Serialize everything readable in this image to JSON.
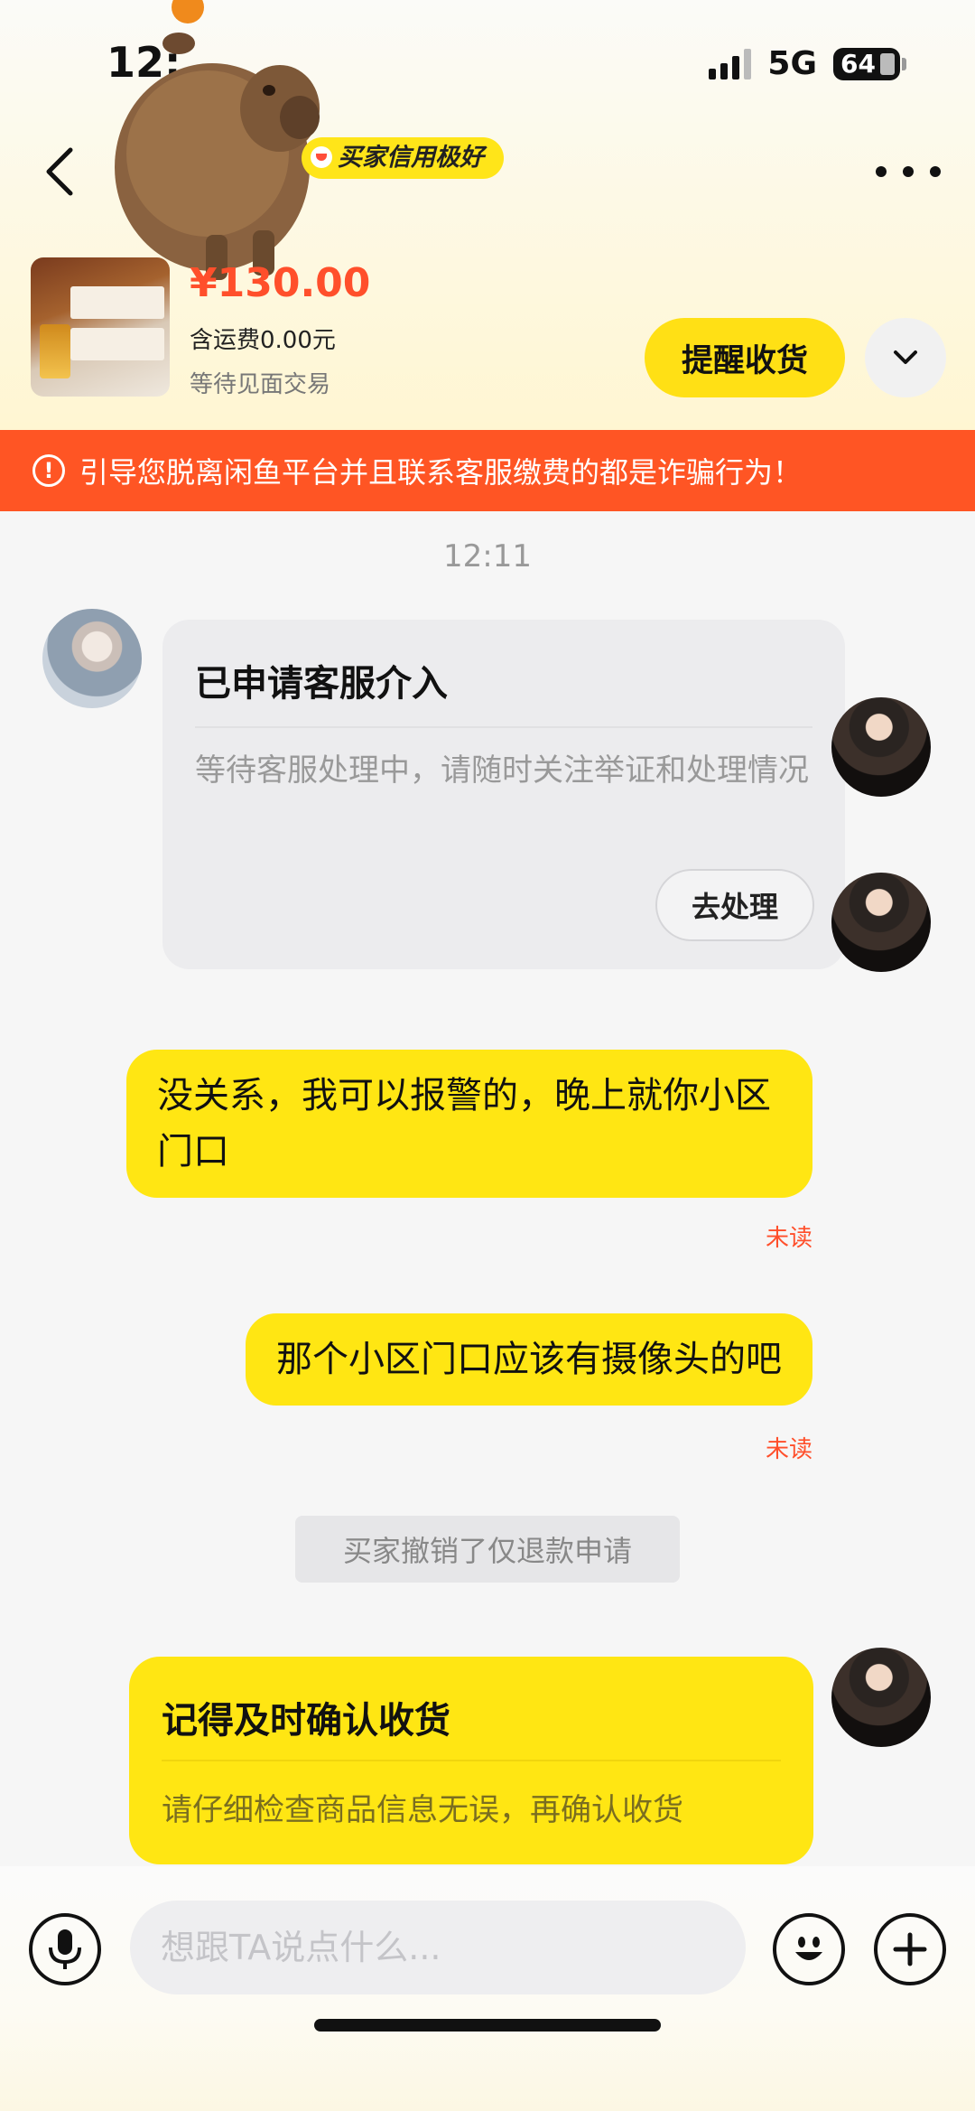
{
  "status_bar": {
    "time": "12:",
    "network": "5G",
    "battery": "64"
  },
  "header": {
    "credit_badge": "买家信用极好",
    "price": "¥130.00",
    "shipping": "含运费0.00元",
    "trade_status": "等待见面交易",
    "remind_button": "提醒收货"
  },
  "warning": {
    "text": "引导您脱离闲鱼平台并且联系客服缴费的都是诈骗行为！"
  },
  "chat": {
    "timestamp": "12:11",
    "service_card": {
      "title": "已申请客服介入",
      "description": "等待客服处理中，请随时关注举证和处理情况",
      "action": "去处理"
    },
    "messages": [
      {
        "text": "没关系，我可以报警的，晚上就你小区门口",
        "status": "未读"
      },
      {
        "text": "那个小区门口应该有摄像头的吧",
        "status": "未读"
      }
    ],
    "system_notice": "买家撤销了仅退款申请",
    "confirm_card": {
      "title": "记得及时确认收货",
      "description": "请仔细检查商品信息无误，再确认收货"
    }
  },
  "input_bar": {
    "placeholder": "想跟TA说点什么..."
  },
  "colors": {
    "accent_yellow": "#ffe613",
    "warning_orange": "#ff5524",
    "price_red": "#ff4f2b"
  },
  "icons": [
    "back-arrow-icon",
    "more-dots-icon",
    "chevron-down-icon",
    "warning-icon",
    "microphone-icon",
    "emoji-icon",
    "plus-icon"
  ]
}
